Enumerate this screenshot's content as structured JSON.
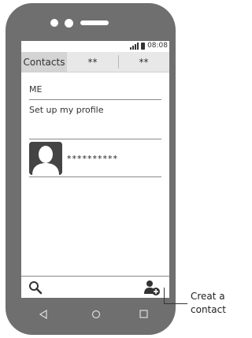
{
  "status": {
    "time": "08:08"
  },
  "tabs": [
    {
      "label": "Contacts"
    },
    {
      "label": "**"
    },
    {
      "label": "**"
    }
  ],
  "me": {
    "section_label": "ME",
    "setup_profile": "Set up my profile"
  },
  "contacts": [
    {
      "name": "**********"
    }
  ],
  "callout": {
    "line1": "Creat a",
    "line2": "contact"
  },
  "colors": {
    "phone_body": "#6f6f6f",
    "tab_bar": "#e8e8e8",
    "active_tab": "#d4d4d4"
  }
}
